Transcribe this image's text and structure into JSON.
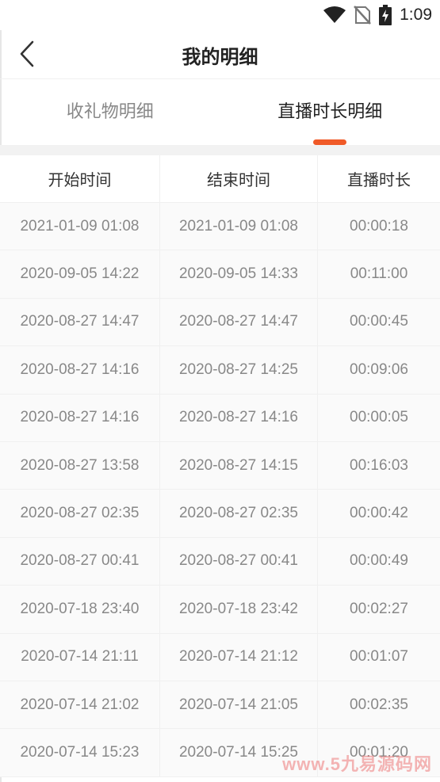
{
  "status_bar": {
    "time": "1:09"
  },
  "header": {
    "title": "我的明细"
  },
  "tabs": [
    {
      "label": "收礼物明细",
      "active": false
    },
    {
      "label": "直播时长明细",
      "active": true
    }
  ],
  "accent_color": "#f05a28",
  "table": {
    "columns": [
      "开始时间",
      "结束时间",
      "直播时长"
    ],
    "rows": [
      [
        "2021-01-09 01:08",
        "2021-01-09 01:08",
        "00:00:18"
      ],
      [
        "2020-09-05 14:22",
        "2020-09-05 14:33",
        "00:11:00"
      ],
      [
        "2020-08-27 14:47",
        "2020-08-27 14:47",
        "00:00:45"
      ],
      [
        "2020-08-27 14:16",
        "2020-08-27 14:25",
        "00:09:06"
      ],
      [
        "2020-08-27 14:16",
        "2020-08-27 14:16",
        "00:00:05"
      ],
      [
        "2020-08-27 13:58",
        "2020-08-27 14:15",
        "00:16:03"
      ],
      [
        "2020-08-27 02:35",
        "2020-08-27 02:35",
        "00:00:42"
      ],
      [
        "2020-08-27 00:41",
        "2020-08-27 00:41",
        "00:00:49"
      ],
      [
        "2020-07-18 23:40",
        "2020-07-18 23:42",
        "00:02:27"
      ],
      [
        "2020-07-14 21:11",
        "2020-07-14 21:12",
        "00:01:07"
      ],
      [
        "2020-07-14 21:02",
        "2020-07-14 21:05",
        "00:02:35"
      ],
      [
        "2020-07-14 15:23",
        "2020-07-14 15:25",
        "00:01:20"
      ]
    ]
  },
  "watermark": "www.5九易源码网"
}
